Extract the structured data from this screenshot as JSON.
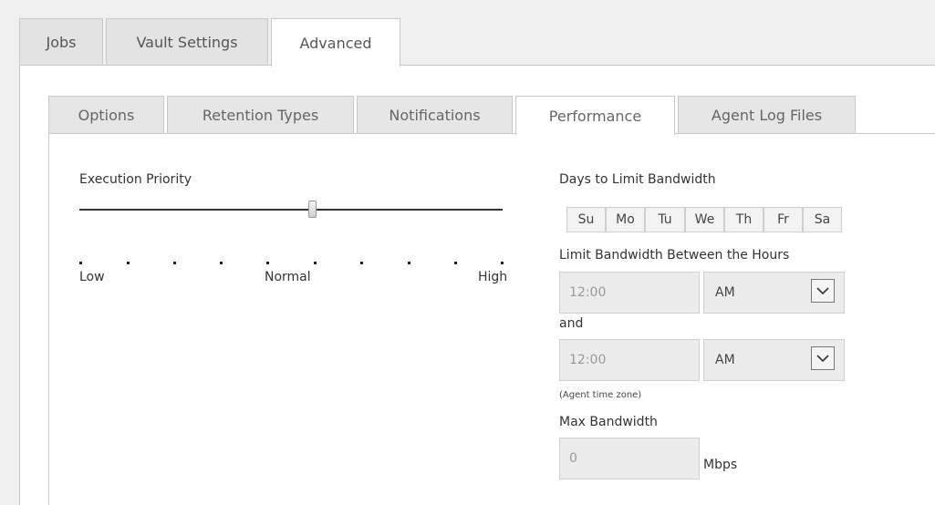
{
  "top_tabs": [
    {
      "label": "Jobs"
    },
    {
      "label": "Vault Settings"
    },
    {
      "label": "Advanced",
      "active": true
    }
  ],
  "sub_tabs": [
    {
      "label": "Options"
    },
    {
      "label": "Retention Types"
    },
    {
      "label": "Notifications"
    },
    {
      "label": "Performance",
      "active": true
    },
    {
      "label": "Agent Log Files"
    }
  ],
  "execution_priority": {
    "label": "Execution Priority",
    "low_label": "Low",
    "normal_label": "Normal",
    "high_label": "High",
    "value_fraction": 0.55
  },
  "bandwidth": {
    "days_label": "Days to Limit Bandwidth",
    "days": [
      "Su",
      "Mo",
      "Tu",
      "We",
      "Th",
      "Fr",
      "Sa"
    ],
    "hours_label": "Limit Bandwidth Between the Hours",
    "start_time": "12:00",
    "start_ampm": "AM",
    "and_label": "and",
    "end_time": "12:00",
    "end_ampm": "AM",
    "timezone_note": "(Agent time zone)",
    "max_label": "Max Bandwidth",
    "max_value": "0",
    "unit": "Mbps"
  },
  "colors": {
    "background": "#f0f0f0",
    "tab_inactive": "#e3e3e3",
    "panel": "#ffffff",
    "field_bg": "#ececec"
  }
}
